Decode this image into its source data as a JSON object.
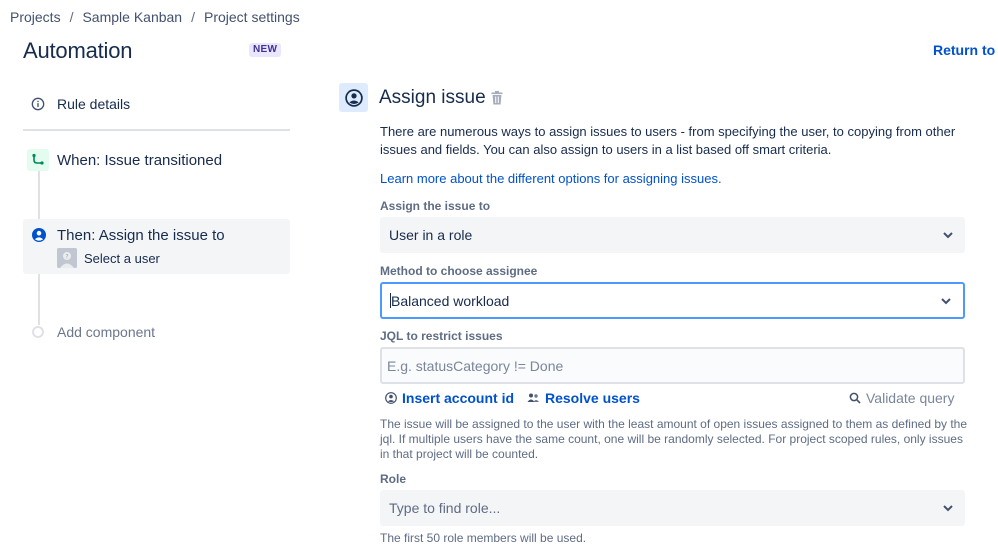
{
  "breadcrumb": [
    "Projects",
    "Sample Kanban",
    "Project settings"
  ],
  "header": {
    "title": "Automation",
    "badge": "NEW",
    "return_link": "Return to li"
  },
  "sidebar": {
    "rule_details": "Rule details",
    "trigger": "When: Issue transitioned",
    "action": {
      "title": "Then: Assign the issue to",
      "subtitle": "Select a user"
    },
    "add_component": "Add component"
  },
  "panel": {
    "title": "Assign issue",
    "description": "There are numerous ways to assign issues to users - from specifying the user, to copying from other issues and fields. You can also assign to users in a list based off smart criteria.",
    "learn_more": "Learn more about the different options for assigning issues.",
    "assign_to": {
      "label": "Assign the issue to",
      "value": "User in a role"
    },
    "method": {
      "label": "Method to choose assignee",
      "value": "Balanced workload"
    },
    "jql": {
      "label": "JQL to restrict issues",
      "placeholder": "E.g. statusCategory != Done",
      "insert_account": "Insert account id",
      "resolve_users": "Resolve users",
      "validate_query": "Validate query",
      "help": "The issue will be assigned to the user with the least amount of open issues assigned to them as defined by the jql. If multiple users have the same count, one will be randomly selected. For project scoped rules, only issues in that project will be counted."
    },
    "role": {
      "label": "Role",
      "placeholder": "Type to find role...",
      "help": "The first 50 role members will be used."
    }
  },
  "colors": {
    "primary_link": "#0052cc",
    "text": "#172b4d",
    "subtle_text": "#5e6c84",
    "focus_border": "#4c9aff",
    "badge_bg": "#eae6ff",
    "badge_text": "#403294",
    "trigger_bg": "#e3fcef",
    "trigger_icon": "#00875a",
    "action_icon": "#0052cc"
  },
  "icons": {
    "rule_details": "info-icon",
    "trigger": "branch-icon",
    "action": "user-circle-icon",
    "panel": "user-circle-icon",
    "delete": "trash-icon",
    "dropdown": "chevron-down-icon",
    "insert_account": "person-icon",
    "resolve_users": "people-icon",
    "validate": "search-icon"
  }
}
